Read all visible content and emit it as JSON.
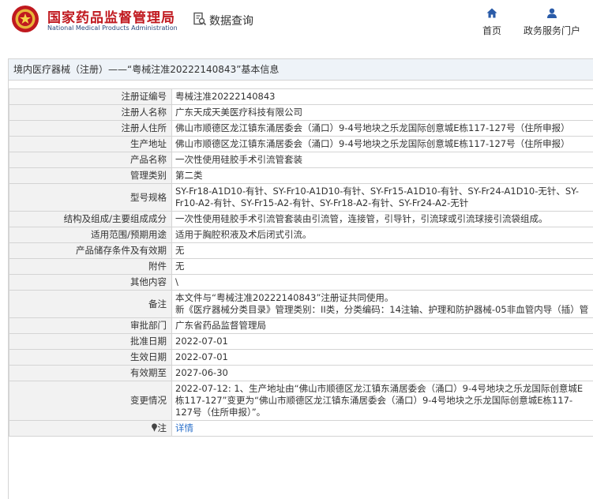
{
  "header": {
    "site_name_cn": "国家药品监督管理局",
    "site_name_en": "National Medical Products Administration",
    "query_label": "数据查询",
    "nav": [
      {
        "label": "首页",
        "icon": "home-icon"
      },
      {
        "label": "政务服务门户",
        "icon": "user-icon"
      }
    ]
  },
  "panel": {
    "title": "境内医疗器械（注册）——“粤械注准20222140843”基本信息"
  },
  "record": {
    "reg_no_label": "注册证编号",
    "reg_no": "粤械注准20222140843",
    "registrant_label": "注册人名称",
    "registrant": "广东天成天美医疗科技有限公司",
    "registrant_addr_label": "注册人住所",
    "registrant_addr": "佛山市顺德区龙江镇东涌居委会（涌口）9-4号地块之乐龙国际创意城E栋117-127号（住所申报）",
    "mfg_addr_label": "生产地址",
    "mfg_addr": "佛山市顺德区龙江镇东涌居委会（涌口）9-4号地块之乐龙国际创意城E栋117-127号（住所申报）",
    "product_name_label": "产品名称",
    "product_name": "一次性使用硅胶手术引流管套装",
    "category_label": "管理类别",
    "category": "第二类",
    "model_label": "型号规格",
    "model": "SY-Fr18-A1D10-有针、SY-Fr10-A1D10-有针、SY-Fr15-A1D10-有针、SY-Fr24-A1D10-无针、SY-Fr10-A2-有针、SY-Fr15-A2-有针、SY-Fr18-A2-有针、SY-Fr24-A2-无针",
    "structure_label": "结构及组成/主要组成成分",
    "structure": "一次性使用硅胶手术引流管套装由引流管，连接管，引导针，引流球或引流球接引流袋组成。",
    "scope_label": "适用范围/预期用途",
    "scope": "适用于胸腔积液及术后闭式引流。",
    "storage_label": "产品储存条件及有效期",
    "storage": "无",
    "attachment_label": "附件",
    "attachment": "无",
    "other_label": "其他内容",
    "other": "\\",
    "remark_label": "备注",
    "remark_line1": "本文件与“粤械注准20222140843”注册证共同使用。",
    "remark_line2": "新《医疗器械分类目录》管理类别：II类，分类编码：14注输、护理和防护器械-05非血管内导（插）管",
    "approver_label": "审批部门",
    "approver": "广东省药品监督管理局",
    "approve_date_label": "批准日期",
    "approve_date": "2022-07-01",
    "effective_date_label": "生效日期",
    "effective_date": "2022-07-01",
    "expiry_label": "有效期至",
    "expiry": "2027-06-30",
    "change_label": "变更情况",
    "change": "2022-07-12: 1、生产地址由“佛山市顺德区龙江镇东涌居委会（涌口）9-4号地块之乐龙国际创意城E栋117-127”变更为“佛山市顺德区龙江镇东涌居委会（涌口）9-4号地块之乐龙国际创意城E栋117-127号（住所申报）”。",
    "note_label": "注",
    "note_icon": "pin-icon",
    "note_link": "详情"
  },
  "colors": {
    "brand_red": "#c0191f",
    "nav_blue": "#2a5ba8",
    "link_blue": "#2a6fc9",
    "label_bg": "#f2f2f2",
    "title_bg": "#eef3f8"
  }
}
